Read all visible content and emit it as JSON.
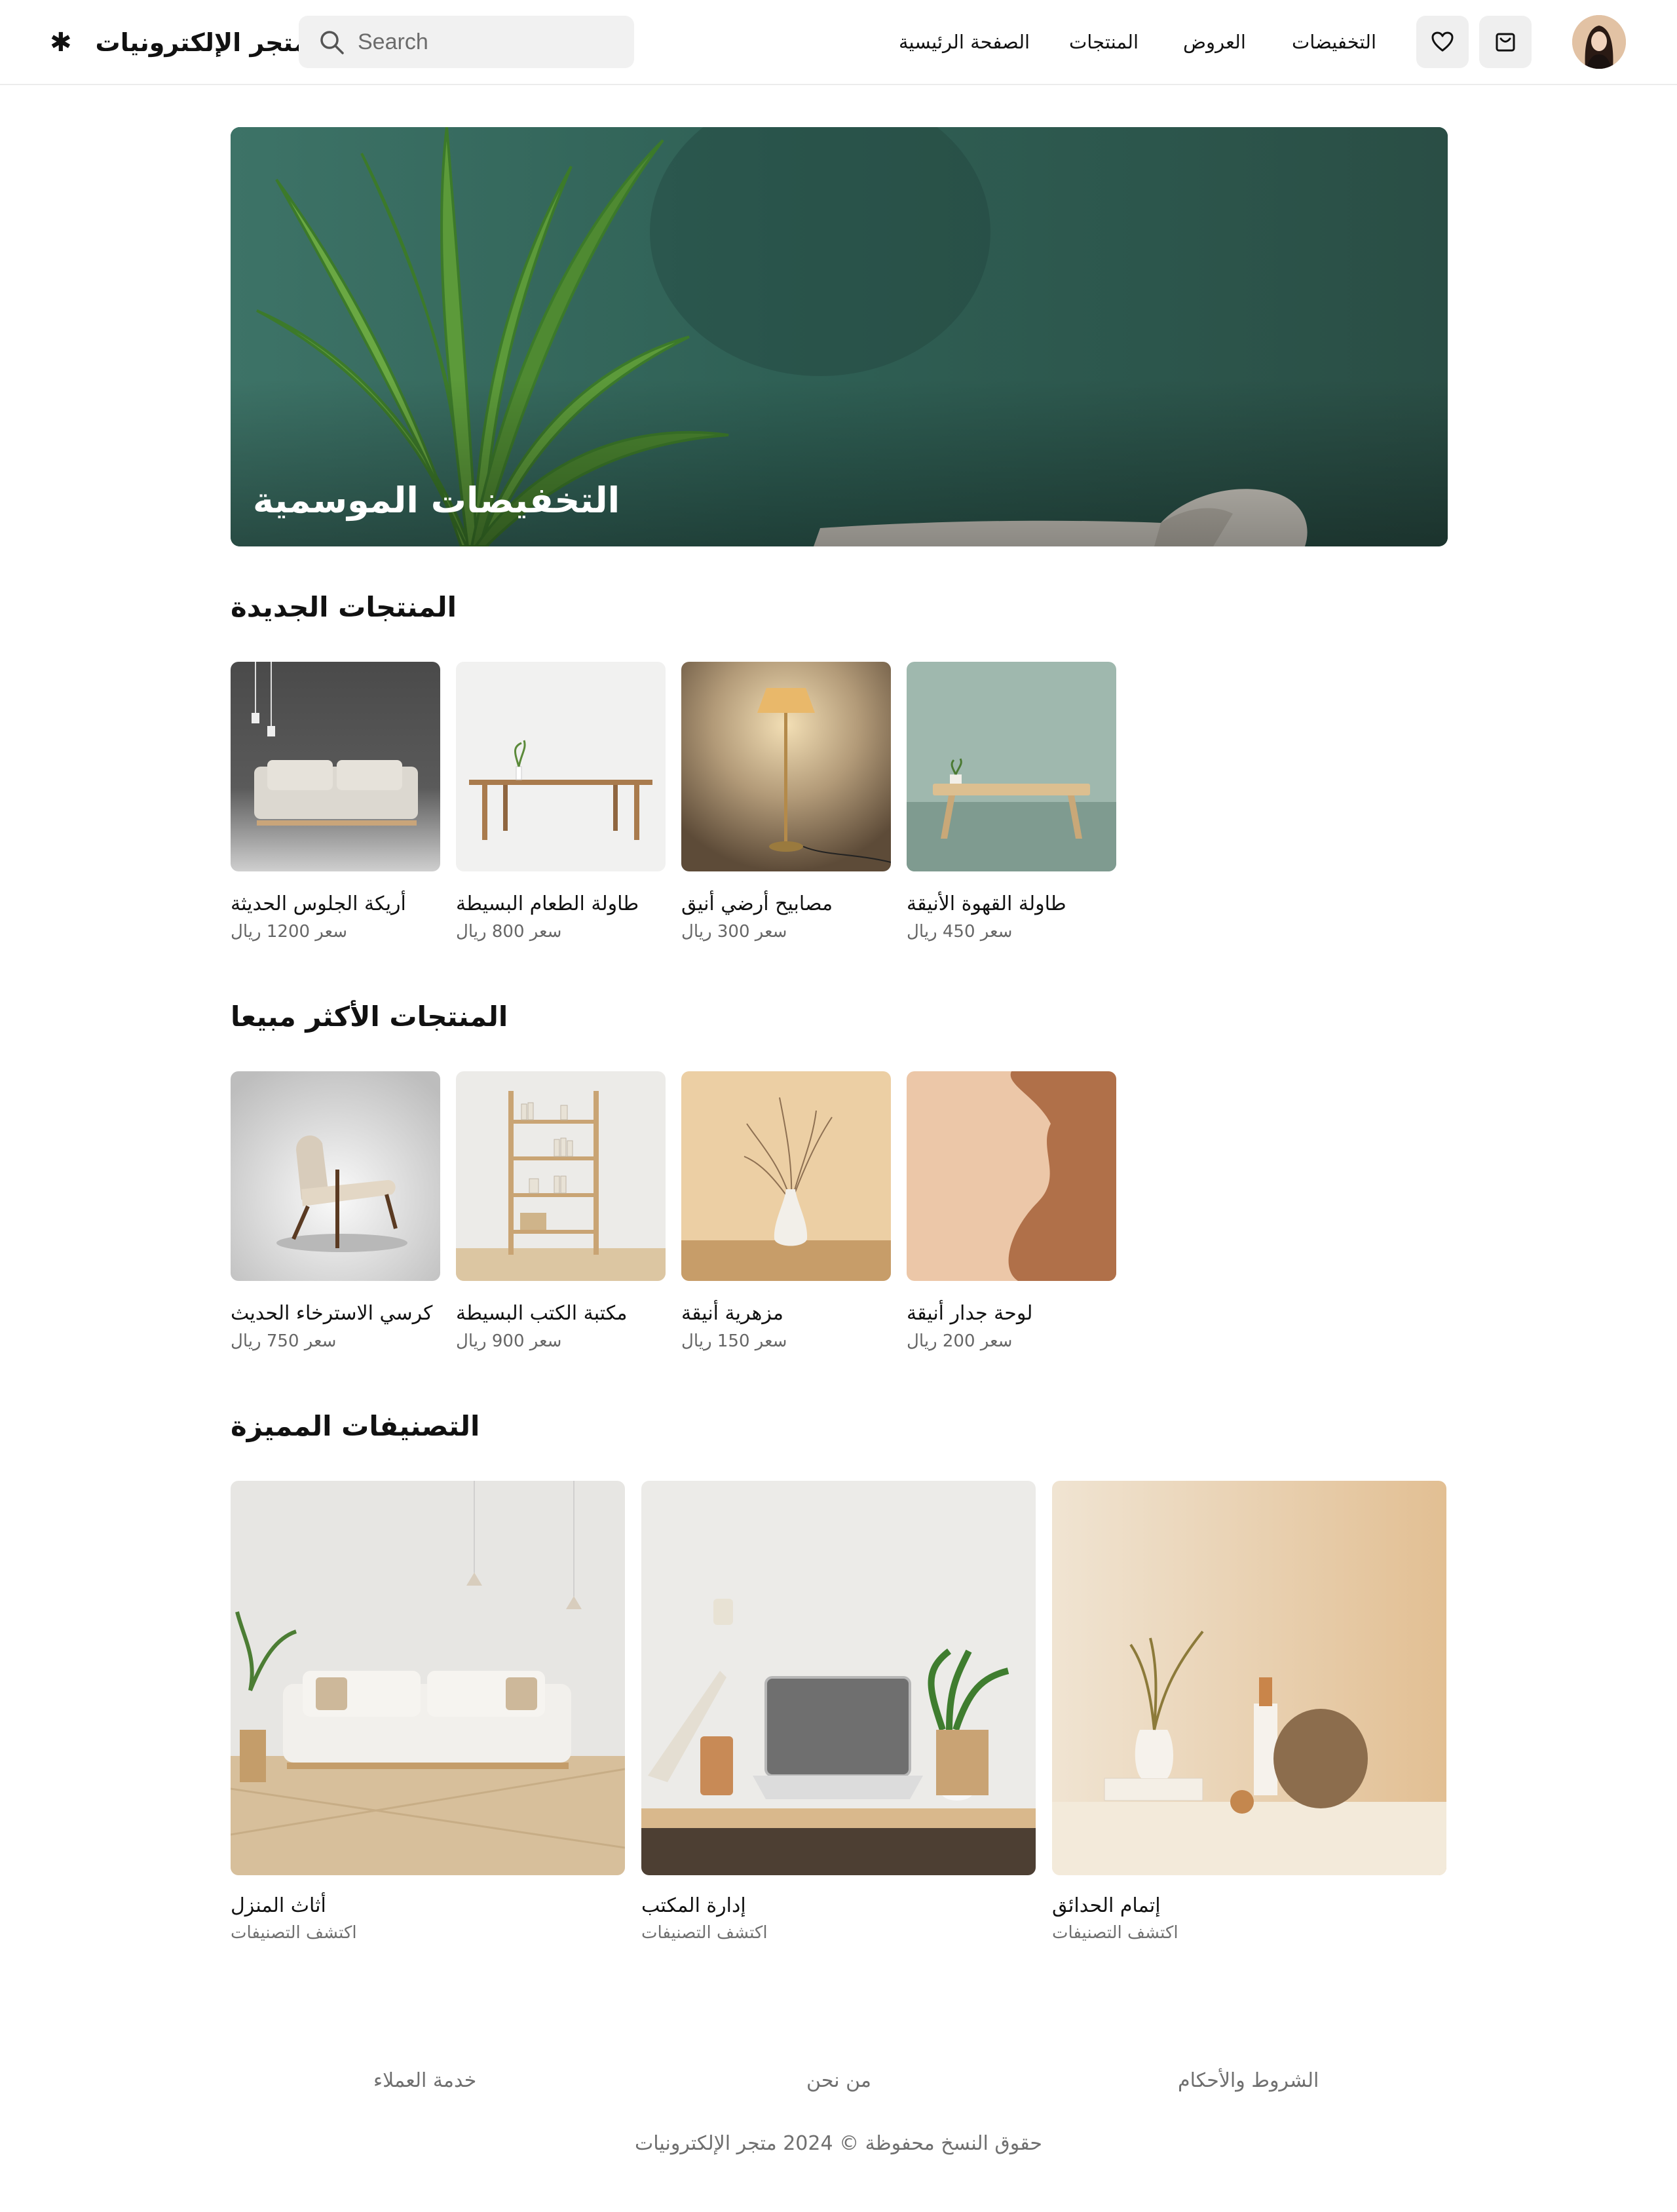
{
  "header": {
    "brand_name": "متجر الإلكترونيات",
    "brand_icon": "asterisk-logo-icon",
    "search": {
      "placeholder": "Search",
      "value": ""
    },
    "nav": [
      "الصفحة الرئيسية",
      "المنتجات",
      "العروض",
      "التخفيضات"
    ],
    "icons": [
      "heart-icon",
      "cart-icon",
      "user-avatar"
    ]
  },
  "hero": {
    "title": "التخفيضات الموسمية"
  },
  "new_products": {
    "title": "المنتجات الجديدة",
    "items": [
      {
        "name": "أريكة الجلوس الحديثة",
        "price": "سعر 1200 ريال"
      },
      {
        "name": "طاولة الطعام البسيطة",
        "price": "سعر 800 ريال"
      },
      {
        "name": "مصابيح أرضي أنيق",
        "price": "سعر 300 ريال"
      },
      {
        "name": "طاولة القهوة الأنيقة",
        "price": "سعر 450 ريال"
      }
    ]
  },
  "best_sellers": {
    "title": "المنتجات الأكثر مبيعا",
    "items": [
      {
        "name": "كرسي الاسترخاء الحديث",
        "price": "سعر 750 ريال"
      },
      {
        "name": "مكتبة الكتب البسيطة",
        "price": "سعر 900 ريال"
      },
      {
        "name": "مزهرية أنيقة",
        "price": "سعر 150 ريال"
      },
      {
        "name": "لوحة جدار أنيقة",
        "price": "سعر 200 ريال"
      }
    ]
  },
  "featured_categories": {
    "title": "التصنيفات المميزة",
    "items": [
      {
        "name": "أثاث المنزل",
        "sub": "اكتشف التصنيفات"
      },
      {
        "name": "إدارة المكتب",
        "sub": "اكتشف التصنيفات"
      },
      {
        "name": "إتمام الحدائق",
        "sub": "اكتشف التصنيفات"
      }
    ]
  },
  "footer": {
    "links": [
      "خدمة العملاء",
      "من نحن",
      "الشروط والأحكام"
    ],
    "copyright": "حقوق النسخ محفوظة © 2024 متجر الإلكترونيات"
  }
}
